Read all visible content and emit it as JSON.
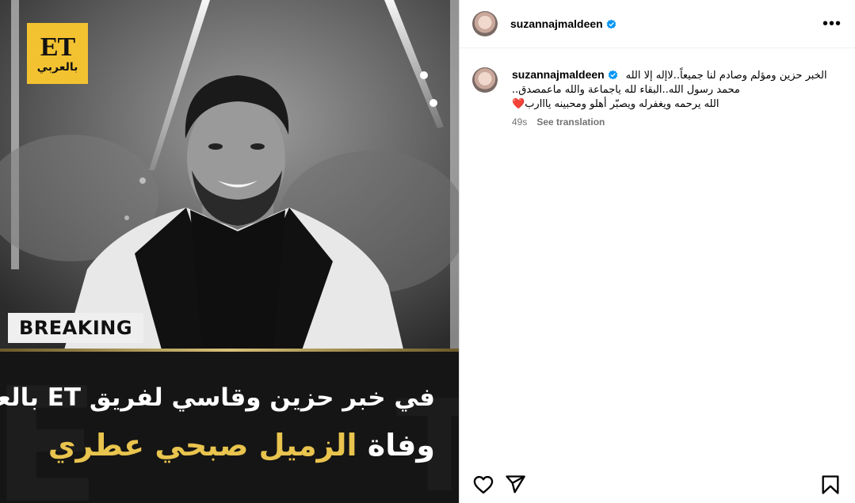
{
  "media": {
    "logo": {
      "main": "ET",
      "sub": "بالعربي"
    },
    "badge": "BREAKING",
    "headline_line1": "في خبر حزين وقاسي لفريق ET بالعربي",
    "headline_line2_prefix": "وفاة",
    "headline_line2_highlight": "الزميل صبحي عطري",
    "highlight_color": "#e9c44e",
    "logo_color": "#f3c231"
  },
  "header": {
    "username": "suzannajmaldeen",
    "verified_icon": "verified-badge-icon",
    "more_icon": "more-options-icon",
    "more_label": "•••"
  },
  "caption": {
    "username": "suzannajmaldeen",
    "line1": "الخبر حزين ومؤلم وصادم لنا جميعاً..لاإله إلا الله",
    "line2": "محمد رسول الله..البقاء لله ياجماعة والله ماعمصدق..",
    "line3": "الله يرحمه ويغفرله ويصبّر أهلو ومحبينه يااارب",
    "line3_emoji": "❤️",
    "time": "49s",
    "translate_label": "See translation"
  },
  "actions": {
    "like_icon": "heart-icon",
    "share_icon": "paper-plane-icon",
    "save_icon": "bookmark-icon"
  },
  "colors": {
    "verified": "#0095f6",
    "meta_text": "#737373"
  }
}
